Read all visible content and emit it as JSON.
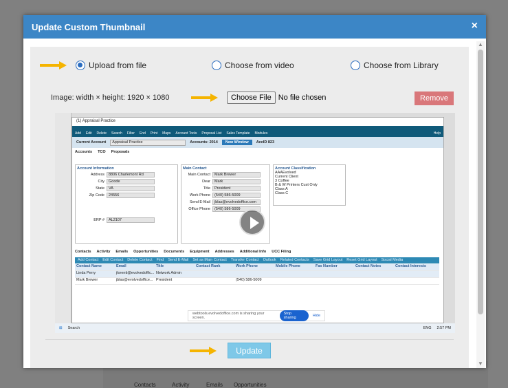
{
  "modal": {
    "title": "Update Custom Thumbnail",
    "close_icon": "×"
  },
  "options": {
    "upload": "Upload from file",
    "video": "Choose from video",
    "library": "Choose from Library",
    "selected": "upload"
  },
  "image_info": "Image: width × height: 1920 × 1080",
  "file_input": {
    "button": "Choose File",
    "status": "No file chosen"
  },
  "remove_label": "Remove",
  "update_label": "Update",
  "colors": {
    "header": "#3c86c6",
    "remove": "#d9777a",
    "update": "#7ec8e8",
    "arrow": "#f5b400"
  },
  "thumbnail": {
    "window_title": "(1) Appraisal Practice",
    "toolbar": [
      "Add",
      "Edit",
      "Delete",
      "Search",
      "Filter",
      "End",
      "Print",
      "Maps",
      "Account Tools",
      "Proposal List",
      "Sales Template",
      "Modules"
    ],
    "help": "Help",
    "current_account_label": "Current Account",
    "current_account": "Appraisal Practice",
    "accounts_count": "Accounts: 2014",
    "new_window": "New Window",
    "acc_id": "AccID   823",
    "tabs": [
      "Accounts",
      "TCO",
      "Proposals"
    ],
    "account_info": {
      "title": "Account Information",
      "fields": [
        [
          "Address",
          "8806 Charlemont Rd"
        ],
        [
          "City",
          "Goode"
        ],
        [
          "State",
          "VA"
        ],
        [
          "Zip Code",
          "24556"
        ],
        [
          "ERP #",
          "AL2107"
        ]
      ]
    },
    "main_contact": {
      "title": "Main Contact",
      "fields": [
        [
          "Main Contact",
          "Mark Brewer"
        ],
        [
          "Dear",
          "Mark"
        ],
        [
          "Title",
          "President"
        ],
        [
          "Work Phone",
          "(540) 586-5009"
        ],
        [
          "Send E-Mail",
          "jblas@evolvedoffice.com"
        ],
        [
          "Office Phone",
          "(540) 586-5009"
        ]
      ]
    },
    "classification": {
      "title": "Account Classification",
      "items": [
        "AAAEvolved",
        "Current Client",
        "3 Coffee",
        "B & W Printers Cust Only",
        "Class A",
        "Class C"
      ]
    },
    "contact_tabs": [
      "Contacts",
      "Activity",
      "Emails",
      "Opportunities",
      "Documents",
      "Equipment",
      "Addresses",
      "Additional Info",
      "UCC Filing"
    ],
    "contact_actions": [
      "Add Contact",
      "Edit Contact",
      "Delete Contact",
      "Find",
      "Send E-Mail",
      "Set as Main Contact",
      "Transfer Contact",
      "Outlook",
      "Related Contacts",
      "Save Grid Layout",
      "Reset Grid Layout",
      "Social Media"
    ],
    "grid_headers": [
      "Contact Name",
      "Email",
      "Title",
      "Contact Rank",
      "Work Phone",
      "Mobile Phone",
      "Fax Number",
      "Contact Notes",
      "Contact Interests"
    ],
    "grid_rows": [
      [
        "Linda Perry",
        "jlorenti@evolvedoffic...",
        "Network Admin",
        "",
        "",
        "",
        "",
        "",
        ""
      ],
      [
        "Mark Brewer",
        "jblas@evolvedoffice...",
        "President",
        "",
        "(540) 586-5009",
        "",
        "",
        "",
        ""
      ]
    ],
    "share_text": "webtools.evolvedoffice.com is sharing your screen.",
    "stop_sharing": "Stop sharing",
    "hide": "Hide",
    "search": "Search",
    "lang": "ENG",
    "time": "2:57 PM"
  }
}
